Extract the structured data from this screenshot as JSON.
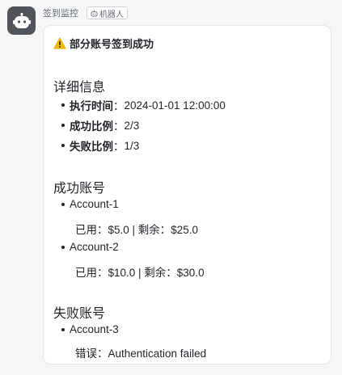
{
  "sender": {
    "name": "签到监控",
    "tag_label": "机器人"
  },
  "card": {
    "title": "部分账号签到成功",
    "title_icon": "warning-icon",
    "detail_section": {
      "heading": "详细信息",
      "items": [
        {
          "key": "执行时间",
          "sep": "：",
          "value": "2024-01-01 12:00:00"
        },
        {
          "key": "成功比例",
          "sep": "：",
          "value": "2/3"
        },
        {
          "key": "失败比例",
          "sep": "：",
          "value": "1/3"
        }
      ]
    },
    "success_section": {
      "heading": "成功账号",
      "accounts": [
        {
          "name": "Account-1",
          "detail": "已用：$5.0 | 剩余：$25.0"
        },
        {
          "name": "Account-2",
          "detail": "已用：$10.0 | 剩余：$30.0"
        }
      ]
    },
    "failed_section": {
      "heading": "失败账号",
      "accounts": [
        {
          "name": "Account-3",
          "detail": "错误：Authentication failed"
        }
      ]
    }
  },
  "colors": {
    "background": "#f5f6f7",
    "avatar": "#50555b",
    "text": "#1f2329",
    "muted": "#646a73",
    "warning": "#f5b800"
  }
}
